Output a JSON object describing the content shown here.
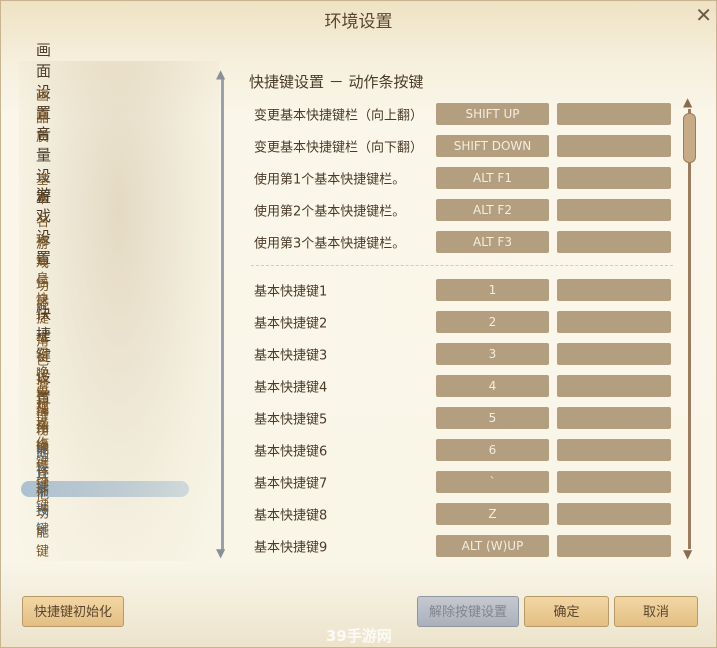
{
  "window": {
    "title": "环境设置",
    "close": "✕"
  },
  "nav": {
    "groups": [
      {
        "heading": "画面设置",
        "items": [
          "画面",
          "品质"
        ]
      },
      {
        "heading": "音量设置",
        "items": [
          "基本"
        ]
      },
      {
        "heading": "游戏设置",
        "items": [
          "名称信息",
          "游戏信息",
          "功能",
          "快捷栏"
        ]
      },
      {
        "heading": "快捷键设置",
        "items": [
          "角色操作键",
          "召唤兽操作键",
          "游戏操作键",
          "视角操作键",
          "功能快捷键",
          "动作条按键",
          "其他功能键"
        ]
      }
    ],
    "selected": "动作条按键"
  },
  "section_title": "快捷键设置 － 动作条按键",
  "rows_top": [
    {
      "label": "变更基本快捷键栏（向上翻）",
      "key": "SHIFT UP",
      "alt": ""
    },
    {
      "label": "变更基本快捷键栏（向下翻）",
      "key": "SHIFT DOWN",
      "alt": ""
    },
    {
      "label": "使用第1个基本快捷键栏。",
      "key": "ALT F1",
      "alt": ""
    },
    {
      "label": "使用第2个基本快捷键栏。",
      "key": "ALT F2",
      "alt": ""
    },
    {
      "label": "使用第3个基本快捷键栏。",
      "key": "ALT F3",
      "alt": ""
    }
  ],
  "rows": [
    {
      "label": "基本快捷键1",
      "key": "1",
      "alt": ""
    },
    {
      "label": "基本快捷键2",
      "key": "2",
      "alt": ""
    },
    {
      "label": "基本快捷键3",
      "key": "3",
      "alt": ""
    },
    {
      "label": "基本快捷键4",
      "key": "4",
      "alt": ""
    },
    {
      "label": "基本快捷键5",
      "key": "5",
      "alt": ""
    },
    {
      "label": "基本快捷键6",
      "key": "6",
      "alt": ""
    },
    {
      "label": "基本快捷键7",
      "key": "`",
      "alt": ""
    },
    {
      "label": "基本快捷键8",
      "key": "Z",
      "alt": ""
    },
    {
      "label": "基本快捷键9",
      "key": "ALT (W)UP",
      "alt": ""
    }
  ],
  "buttons": {
    "reset": "快捷键初始化",
    "unbind": "解除按键设置",
    "ok": "确定",
    "cancel": "取消"
  },
  "watermark": "39手游网"
}
